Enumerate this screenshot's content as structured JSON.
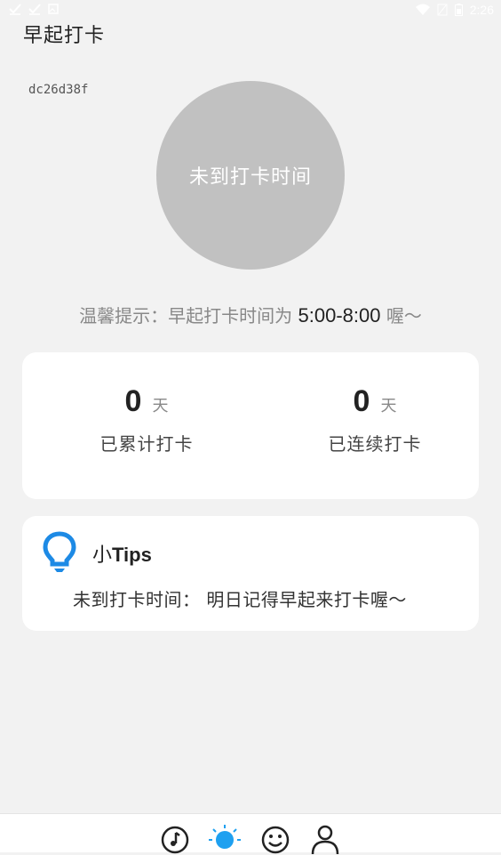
{
  "status_bar": {
    "time": "2:26",
    "left_icons": [
      "check-icon",
      "check-icon",
      "image-icon"
    ],
    "right_icons": [
      "wifi-icon",
      "signal-off-icon",
      "battery-icon"
    ]
  },
  "header": {
    "title": "早起打卡"
  },
  "user": {
    "id": "dc26d38f"
  },
  "checkin": {
    "button_label": "未到打卡时间",
    "button_color": "#c1c1c1"
  },
  "hint": {
    "prefix": "温馨提示：早起打卡时间为 ",
    "time_range": "5:00-8:00",
    "suffix": " 喔～"
  },
  "stats": {
    "total": {
      "value": "0",
      "unit": "天",
      "label": "已累计打卡"
    },
    "streak": {
      "value": "0",
      "unit": "天",
      "label": "已连续打卡"
    }
  },
  "tips": {
    "title_prefix": "小",
    "title_suffix": "Tips",
    "message": "未到打卡时间： 明日记得早起来打卡喔～",
    "icon": "lightbulb-icon",
    "icon_color": "#1d8ae5"
  },
  "bottom_nav": {
    "items": [
      {
        "icon": "music-note-icon",
        "active": false
      },
      {
        "icon": "sun-icon",
        "active": true
      },
      {
        "icon": "smiley-icon",
        "active": false
      },
      {
        "icon": "person-icon",
        "active": false
      }
    ],
    "active_color": "#1ea0f0"
  }
}
